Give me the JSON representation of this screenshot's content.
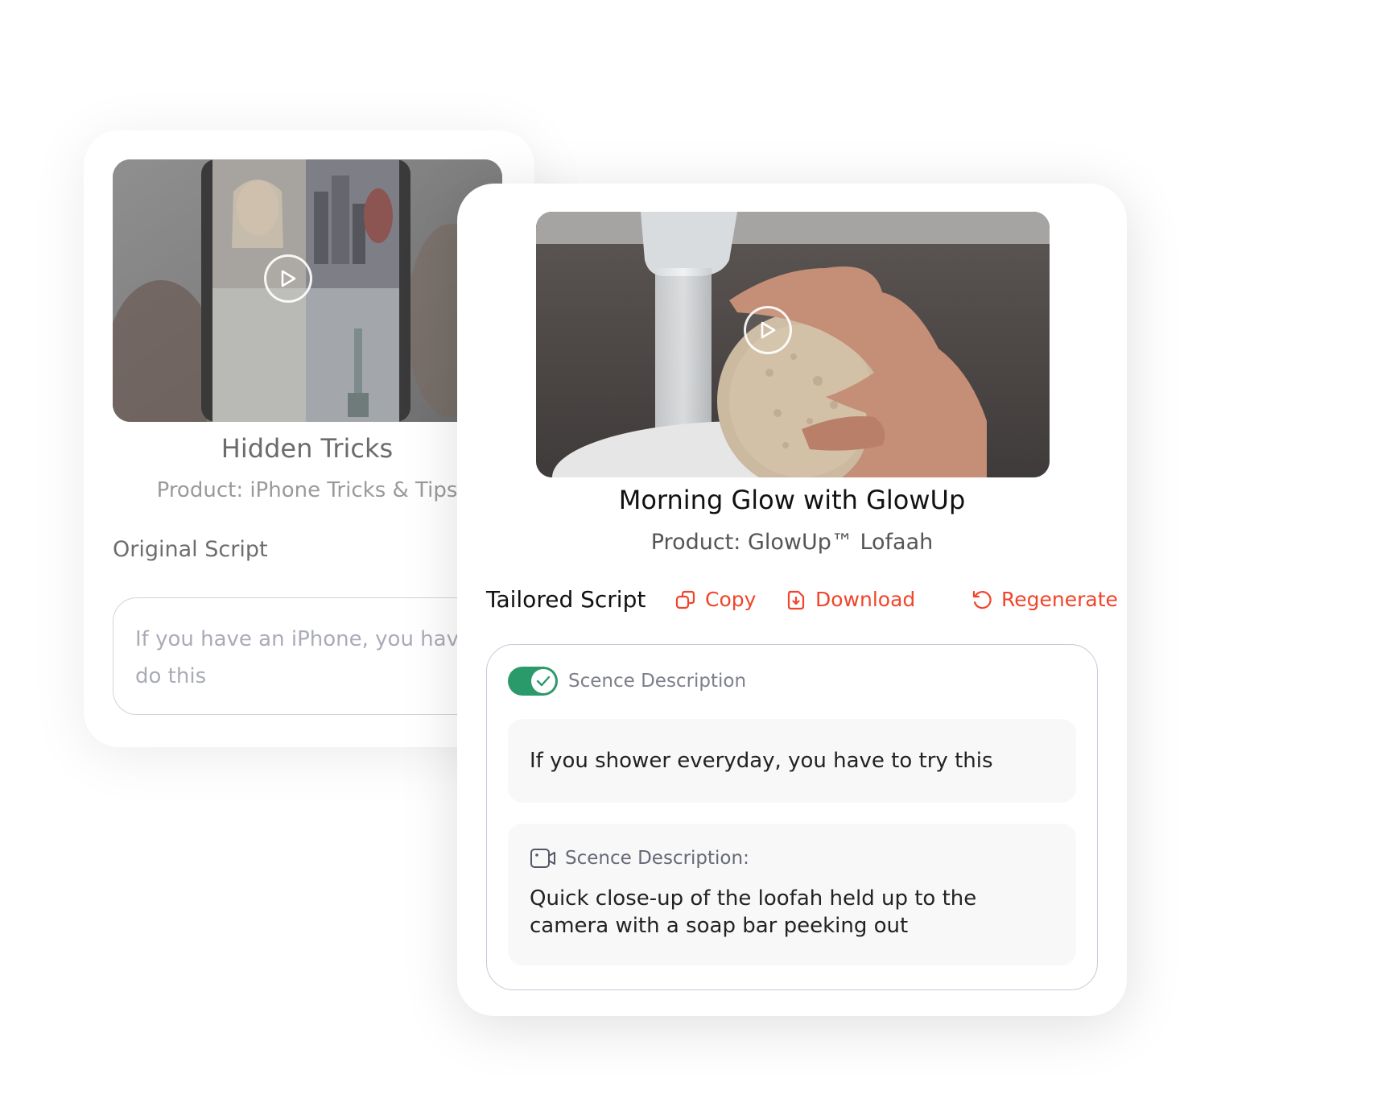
{
  "original_card": {
    "title": "Hidden Tricks",
    "product": "Product: iPhone Tricks & Tips",
    "script_label": "Original Script",
    "script_placeholder": "If you have an iPhone, you have to do this"
  },
  "tailored_card": {
    "title": "Morning Glow with GlowUp",
    "product": "Product: GlowUp™ Lofaah",
    "script_label": "Tailored Script",
    "actions": {
      "copy": "Copy",
      "download": "Download",
      "regenerate": "Regenerate"
    },
    "toggle": {
      "label": "Scence Description",
      "on": true
    },
    "script_line": "If you shower everyday, you have to try this",
    "scene": {
      "heading": "Scence Description:",
      "text": "Quick close-up of the loofah held up to the camera with a soap bar peeking out"
    }
  },
  "colors": {
    "accent": "#f0452a",
    "toggle_on": "#2b9a6a"
  }
}
